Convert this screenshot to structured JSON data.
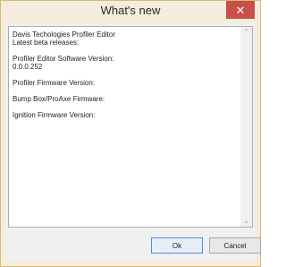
{
  "window": {
    "title": "What's new",
    "close_glyph": "✕"
  },
  "content": {
    "text": "Davis Techologies Profiler Editor\nLatest beta releases:\n\nProfiler Editor Software Version:\n0.0.0.252\n\nProfiler Firmware Version:\n\nBump Box/ProAxe Firmware:\n\nIgnition Firmware Version:"
  },
  "scrollbar": {
    "up_glyph": "⌃",
    "down_glyph": "⌄"
  },
  "buttons": {
    "ok_label": "Ok",
    "cancel_label": "Cancel"
  },
  "colors": {
    "frame": "#f4ecdd",
    "close": "#c7504a",
    "ok_focus_border": "#4c8fd6"
  }
}
